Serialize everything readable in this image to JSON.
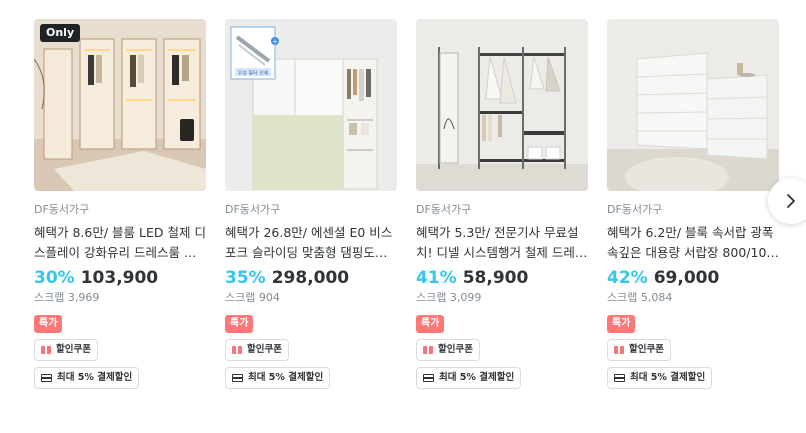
{
  "products": [
    {
      "badge": "Only",
      "brand": "DF동서가구",
      "title": "혜택가 8.6만/ 블룸 LED 철제 디스플레이 강화유리 드레스룸 행거형...",
      "discount": "30%",
      "price": "103,900",
      "scrap": "스크랩 3,969",
      "special": "특가",
      "coupon": "할인쿠폰",
      "payment": "최대 5% 결제할인",
      "image": "walk-in-closet-led"
    },
    {
      "badge": "",
      "inset_label": "우성 필터 인쇄",
      "brand": "DF동서가구",
      "title": "혜택가 26.8만/ 에센셜 E0 비스포크 슬라이딩 맞춤형 댐핑도어 옷...",
      "discount": "35%",
      "price": "298,000",
      "scrap": "스크랩 904",
      "special": "특가",
      "coupon": "할인쿠폰",
      "payment": "최대 5% 결제할인",
      "image": "sliding-wardrobe"
    },
    {
      "badge": "",
      "brand": "DF동서가구",
      "title": "혜택가 5.3만/ 전문기사 무료설치! 디넬 시스템행거 철제 드레스룸 4...",
      "discount": "41%",
      "price": "58,900",
      "scrap": "스크랩 3,099",
      "special": "특가",
      "coupon": "할인쿠폰",
      "payment": "최대 5% 결제할인",
      "image": "system-hanger"
    },
    {
      "badge": "",
      "brand": "DF동서가구",
      "title": "혜택가 6.2만/ 블룩 속서랍 광폭 속깊은 대용량 서랍장 800/1000/1...",
      "discount": "42%",
      "price": "69,000",
      "scrap": "스크랩 5,084",
      "special": "특가",
      "coupon": "할인쿠폰",
      "payment": "최대 5% 결제할인",
      "image": "drawer-chest"
    }
  ],
  "next_icon": "chevron-right-icon",
  "colors": {
    "discount": "#35c5f0",
    "special_badge": "#ff7777",
    "text": "#2f3438",
    "muted": "#828c94"
  }
}
